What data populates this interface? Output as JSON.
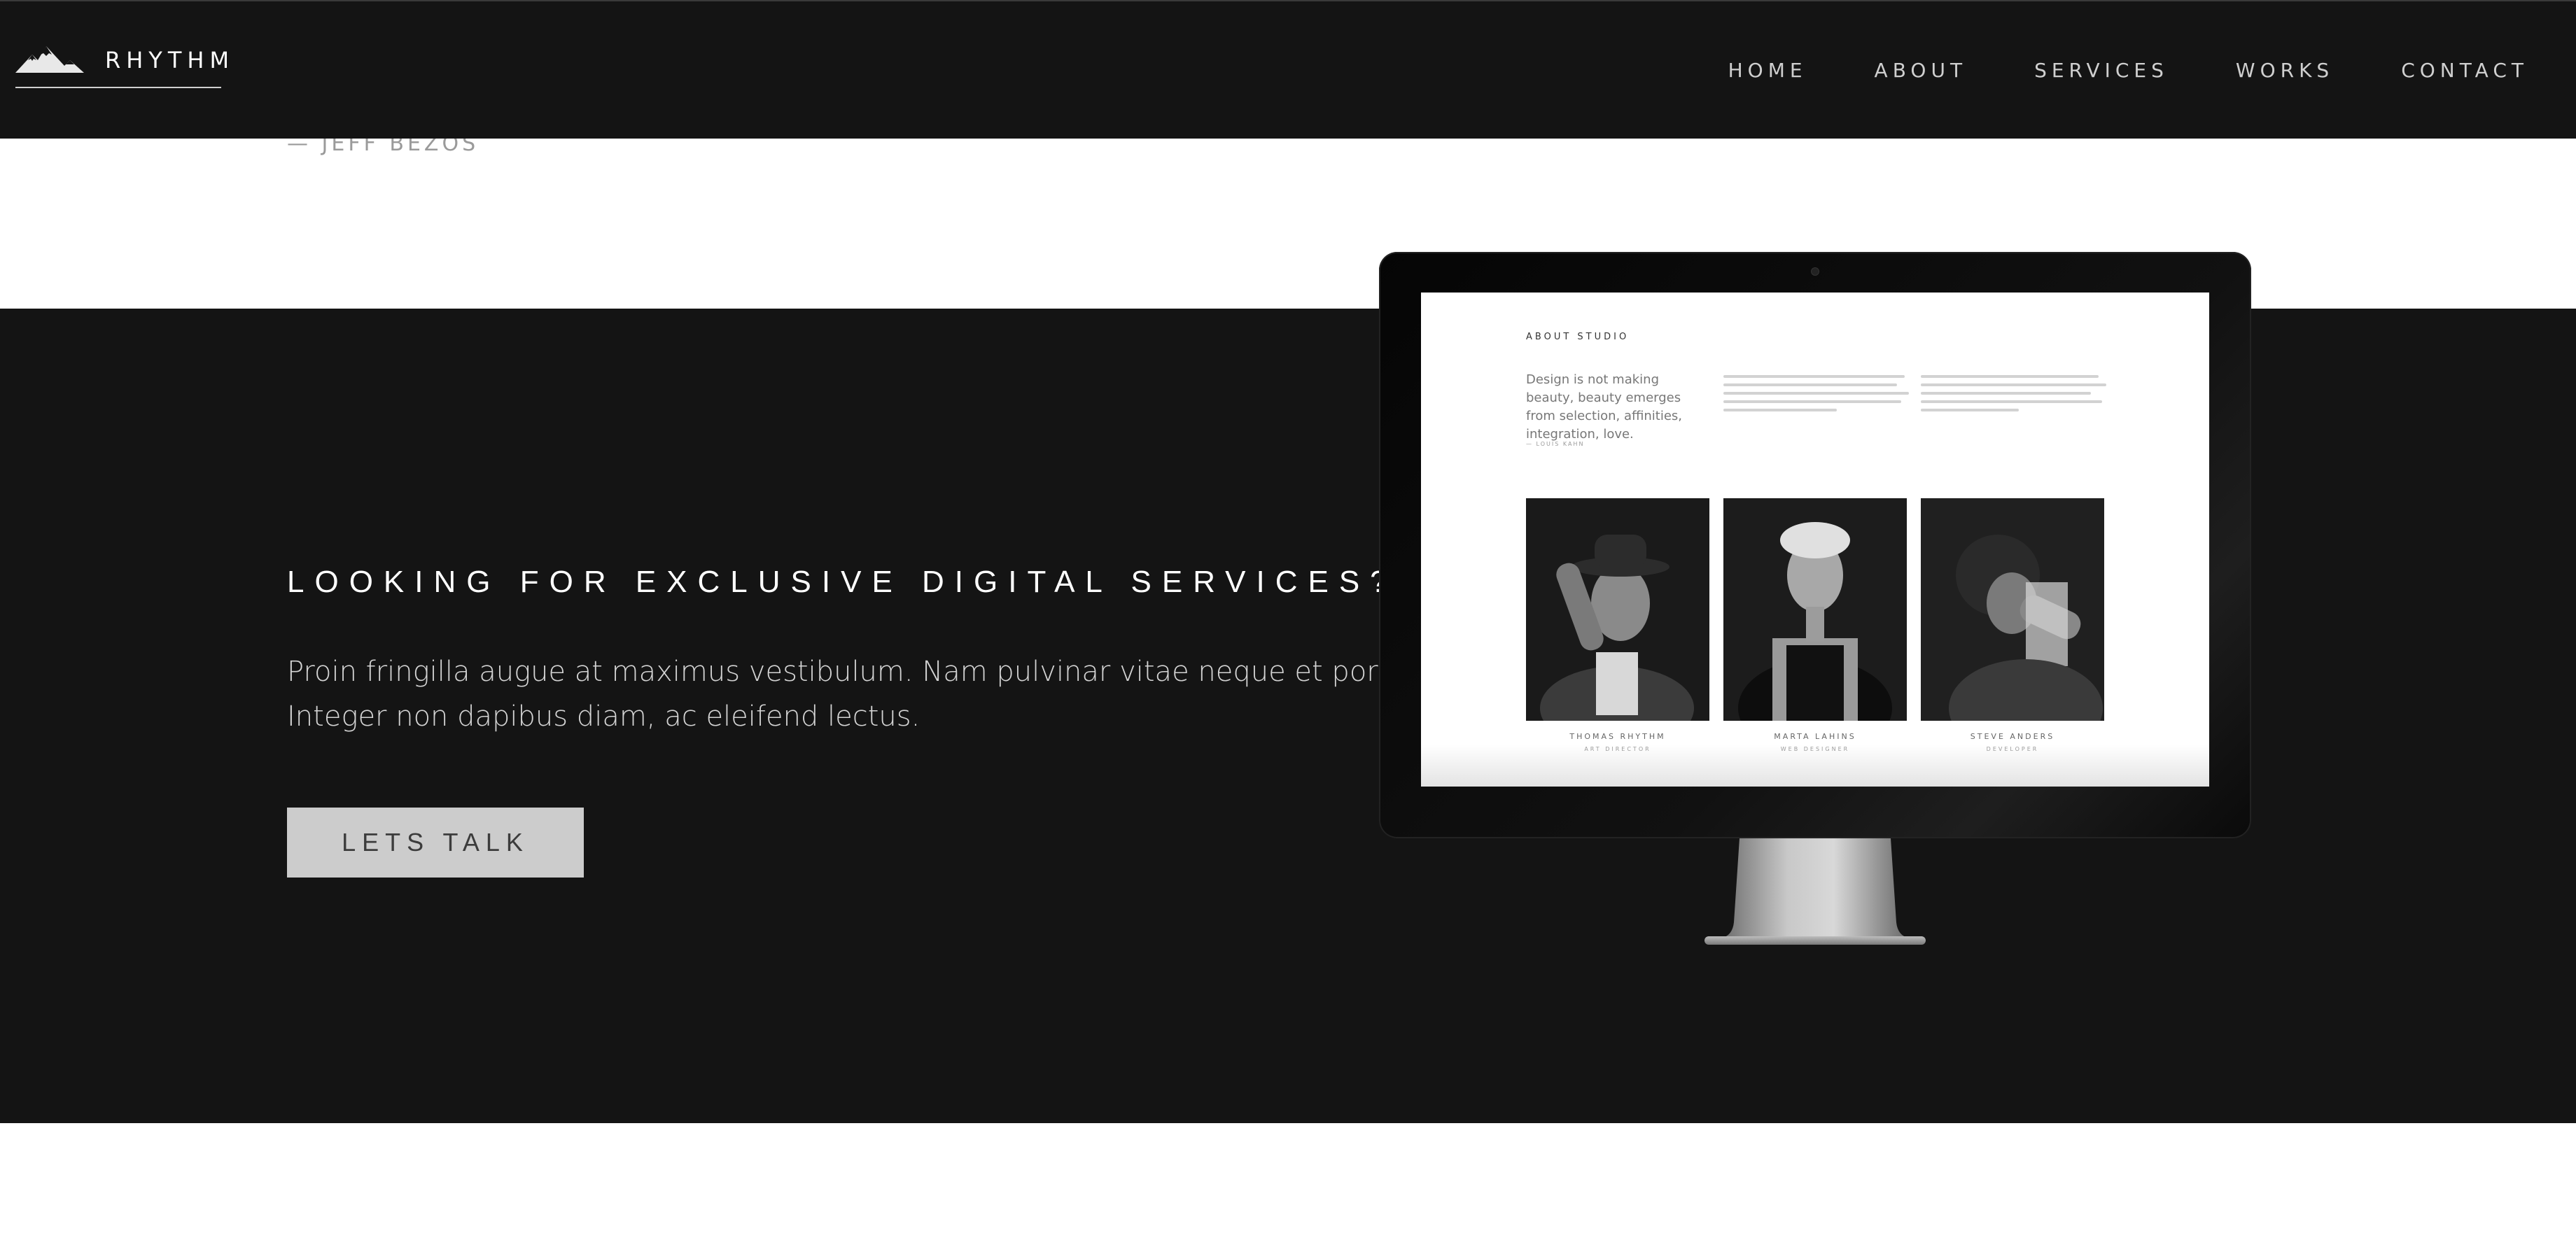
{
  "nav": {
    "brand": "RHYTHM",
    "links": [
      "HOME",
      "ABOUT",
      "SERVICES",
      "WORKS",
      "CONTACT"
    ]
  },
  "quote": {
    "author": "— JEFF BEZOS"
  },
  "cta_section": {
    "headline": "LOOKING FOR EXCLUSIVE DIGITAL SERVICES?",
    "body_line_1": "Proin fringilla augue at maximus vestibulum. Nam pulvinar vitae neque et porttitor.",
    "body_line_2": "Integer non dapibus diam, ac eleifend lectus.",
    "button_label": "LETS TALK"
  },
  "mockup": {
    "section_title": "ABOUT STUDIO",
    "quote": "Design is not making beauty, beauty emerges from selection, affinities, integration, love.",
    "quote_author": "— LOUIS KAHN",
    "team": [
      {
        "name": "THOMAS RHYTHM",
        "role": "ART DIRECTOR"
      },
      {
        "name": "MARTA LAHINS",
        "role": "WEB DESIGNER"
      },
      {
        "name": "STEVE ANDERS",
        "role": "DEVELOPER"
      }
    ]
  },
  "colors": {
    "dark_bg": "#141414",
    "button_bg": "#cccccc",
    "nav_text": "#cfcfcf"
  }
}
